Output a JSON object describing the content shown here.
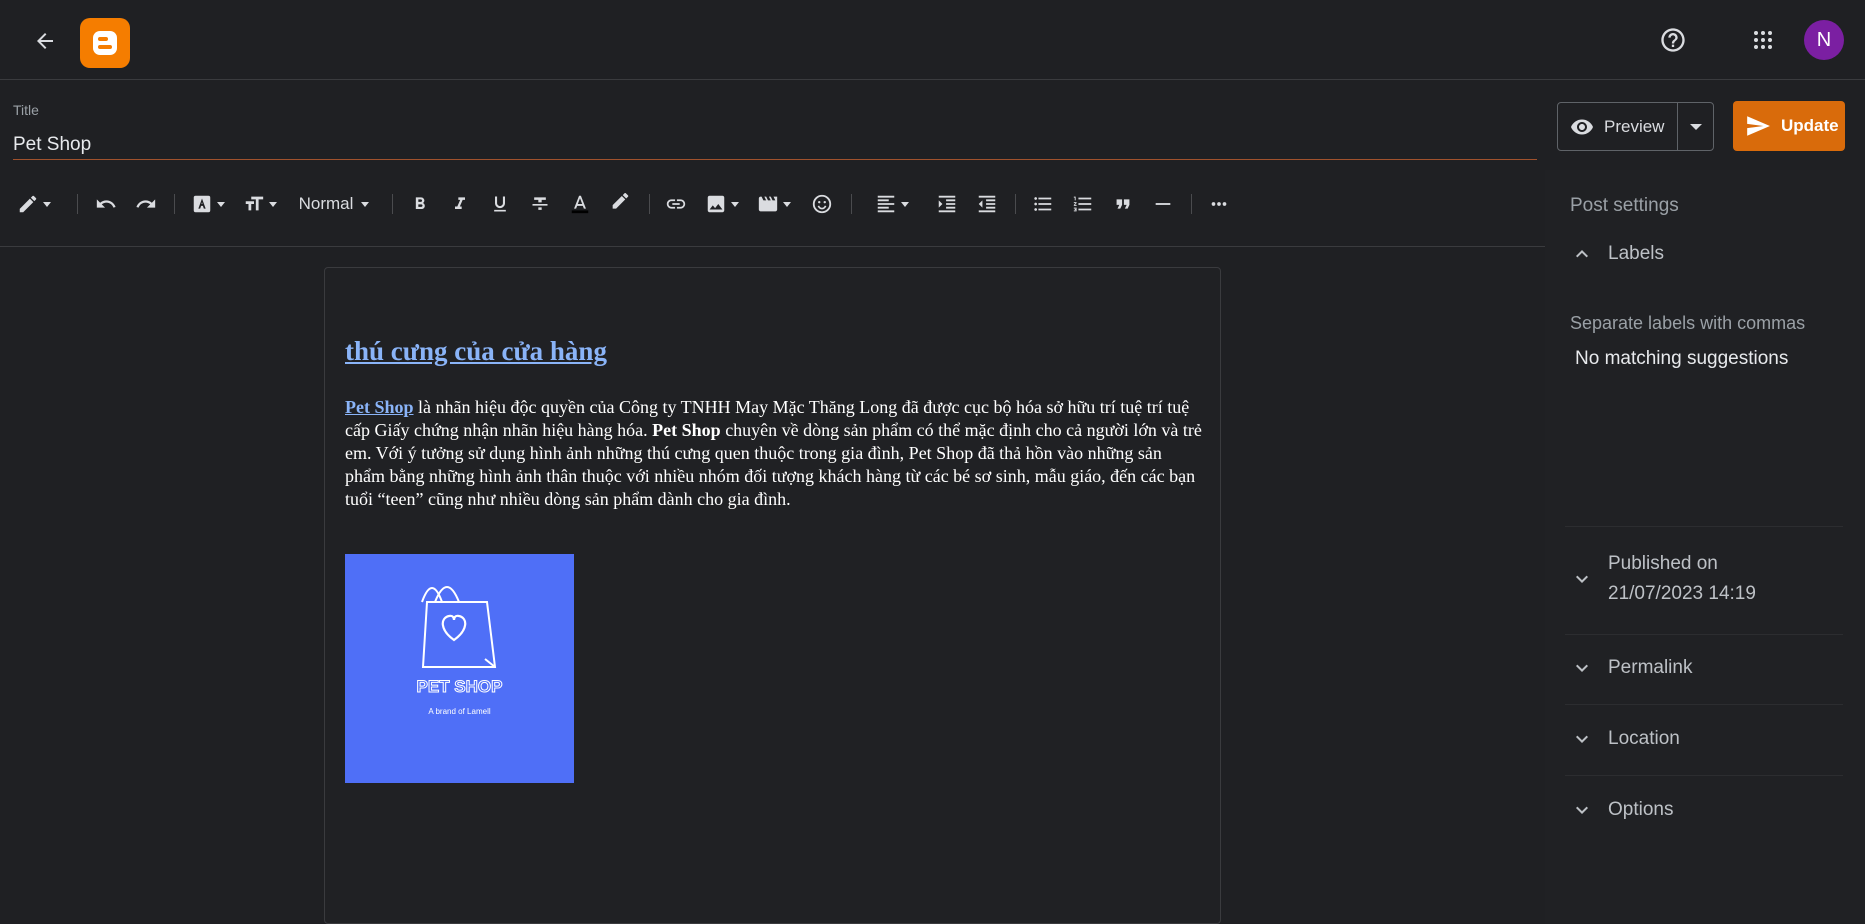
{
  "header": {
    "back_label": "Back",
    "logo_name": "blogger-logo",
    "avatar_letter": "N"
  },
  "title_section": {
    "label": "Title",
    "value": "Pet Shop"
  },
  "actions": {
    "preview_label": "Preview",
    "update_label": "Update"
  },
  "toolbar": {
    "paragraph_style": "Normal"
  },
  "post": {
    "heading": "thú cưng của cửa hàng",
    "brand_link": "Pet Shop",
    "para_part1": " là nhãn hiệu độc quyền của Công ty TNHH May Mặc Thăng Long đã được cục bộ hóa sở hữu trí tuệ trí tuệ cấp Giấy chứng nhận nhãn hiệu hàng hóa. ",
    "brand_bold": "Pet Shop",
    "para_part2": " chuyên về dòng sản phẩm có thể mặc định cho cả người lớn và trẻ em. Với ý tưởng sử dụng hình ảnh những thú cưng quen thuộc trong gia đình, Pet Shop đã thả hồn vào những sản phẩm bằng những hình ảnh thân thuộc với nhiều nhóm đối tượng khách hàng từ các bé sơ sinh, mẫu giáo, đến các bạn tuổi “teen” cũng như nhiều dòng sản phẩm dành cho gia đình.",
    "image": {
      "logo_title": "PET SHOP",
      "logo_subtitle": "A brand of Lamell",
      "bg_color": "#4f6ff7"
    }
  },
  "sidebar": {
    "title": "Post settings",
    "labels_label": "Labels",
    "labels_hint": "Separate labels with commas",
    "labels_suggestions": "No matching suggestions",
    "published_label": "Published on",
    "published_value": "21/07/2023 14:19",
    "permalink_label": "Permalink",
    "location_label": "Location",
    "options_label": "Options"
  },
  "colors": {
    "accent": "#d96b0b",
    "link": "#8ab4f8",
    "avatar": "#7b1fa2",
    "logo": "#f57d00"
  }
}
